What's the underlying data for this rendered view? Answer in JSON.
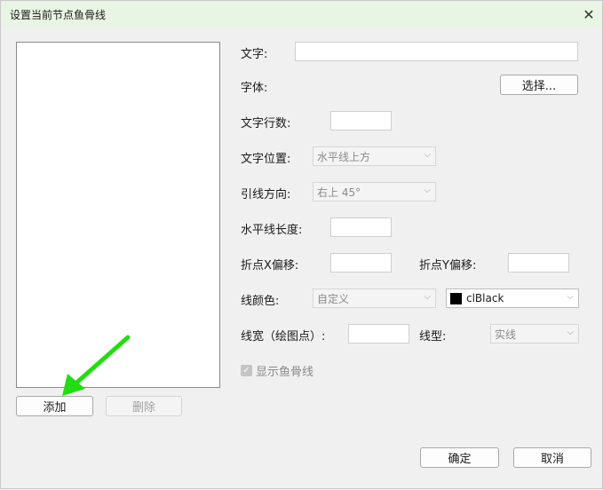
{
  "window": {
    "title": "设置当前节点鱼骨线"
  },
  "icons": {
    "close": "close-icon",
    "dropdown": "chevron-down-icon",
    "check": "check-icon",
    "annotation": "green-arrow-icon"
  },
  "colors": {
    "titlebar": "#e9f5e4",
    "annotation_arrow": "#22dd11",
    "swatch": "#000000"
  },
  "left": {
    "add_label": "添加",
    "delete_label": "删除"
  },
  "form": {
    "text_label": "文字:",
    "text_value": "",
    "font_label": "字体:",
    "font_button": "选择...",
    "rows_label": "文字行数:",
    "rows_value": "",
    "position_label": "文字位置:",
    "position_value": "水平线上方",
    "direction_label": "引线方向:",
    "direction_value": "右上 45°",
    "hline_length_label": "水平线长度:",
    "hline_length_value": "",
    "offset_x_label": "折点X偏移:",
    "offset_x_value": "",
    "offset_y_label": "折点Y偏移:",
    "offset_y_value": "",
    "color_label": "线颜色:",
    "color_mode_value": "自定义",
    "color_value": "clBlack",
    "width_label": "线宽（绘图点）:",
    "width_value": "",
    "style_label": "线型:",
    "style_value": "实线",
    "show_fishbone_label": "显示鱼骨线",
    "show_fishbone_checked": true
  },
  "footer": {
    "ok_label": "确定",
    "cancel_label": "取消"
  }
}
